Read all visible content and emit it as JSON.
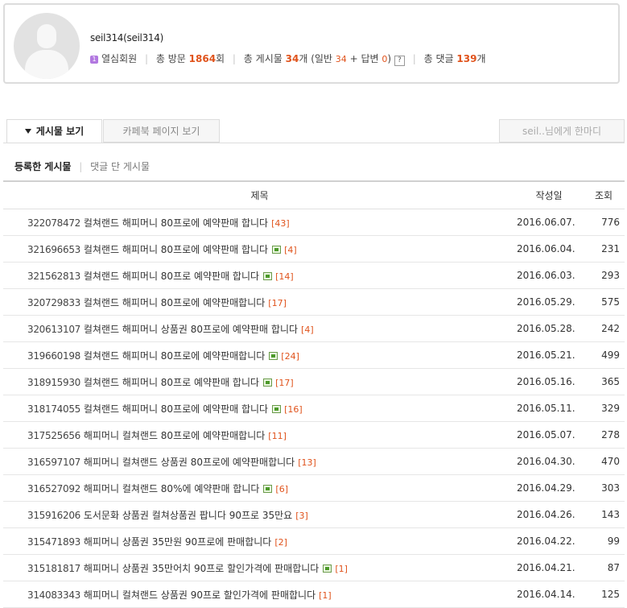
{
  "profile": {
    "nickname": "seil314(seil314)",
    "level_badge": "1",
    "rank": "열심회원",
    "visits_label": "총 방문",
    "visits": "1864",
    "visits_unit": "회",
    "posts_label": "총 게시물",
    "posts": "34",
    "posts_unit": "개",
    "general_label": "(일반",
    "general": "34",
    "plus": "+",
    "reply_label": "답변",
    "reply": "0",
    "close_paren": ")",
    "help_label": "?",
    "comments_label": "총 댓글",
    "comments": "139",
    "comments_unit": "개"
  },
  "tabs": {
    "posts": "게시물 보기",
    "facebook": "카페북 페이지 보기",
    "message": "seil..님에게 한마디"
  },
  "subtabs": {
    "written": "등록한 게시물",
    "commented": "댓글 단 게시물"
  },
  "table": {
    "headers": {
      "title": "제목",
      "date": "작성일",
      "views": "조회"
    },
    "rows": [
      {
        "id": "322078472",
        "title": "컬쳐랜드 해피머니 80프로에 예약판매 합니다",
        "image": false,
        "comments": "[43]",
        "date": "2016.06.07.",
        "views": "776"
      },
      {
        "id": "321696653",
        "title": "컬쳐랜드 해피머니 80프로에 예약판매 합니다",
        "image": true,
        "comments": "[4]",
        "date": "2016.06.04.",
        "views": "231"
      },
      {
        "id": "321562813",
        "title": "컬쳐랜드 해피머니 80프로 예약판매 합니다",
        "image": true,
        "comments": "[14]",
        "date": "2016.06.03.",
        "views": "293"
      },
      {
        "id": "320729833",
        "title": "컬쳐랜드 해피머니 80프로에 예약판매합니다",
        "image": false,
        "comments": "[17]",
        "date": "2016.05.29.",
        "views": "575"
      },
      {
        "id": "320613107",
        "title": "컬쳐랜드 해피머니 상품권 80프로에 예약판매 합니다",
        "image": false,
        "comments": "[4]",
        "date": "2016.05.28.",
        "views": "242"
      },
      {
        "id": "319660198",
        "title": "컬쳐랜드 해피머니 80프로에 예약판매합니다",
        "image": true,
        "comments": "[24]",
        "date": "2016.05.21.",
        "views": "499"
      },
      {
        "id": "318915930",
        "title": "컬쳐랜드 해피머니 80프로 예약판매 합니다",
        "image": true,
        "comments": "[17]",
        "date": "2016.05.16.",
        "views": "365"
      },
      {
        "id": "318174055",
        "title": "컬쳐랜드 해피머니 80프로에 예약판매 합니다",
        "image": true,
        "comments": "[16]",
        "date": "2016.05.11.",
        "views": "329"
      },
      {
        "id": "317525656",
        "title": "해피머니 컬쳐랜드 80프로에 예약판매합니다",
        "image": false,
        "comments": "[11]",
        "date": "2016.05.07.",
        "views": "278"
      },
      {
        "id": "316597107",
        "title": "해피머니 컬쳐랜드 상품권 80프로에 예약판매합니다",
        "image": false,
        "comments": "[13]",
        "date": "2016.04.30.",
        "views": "470"
      },
      {
        "id": "316527092",
        "title": "해피머니 컬쳐랜드 80%에 예약판매 합니다",
        "image": true,
        "comments": "[6]",
        "date": "2016.04.29.",
        "views": "303"
      },
      {
        "id": "315916206",
        "title": "도서문화 상품권 컬쳐상품권 팝니다 90프로 35만요",
        "image": false,
        "comments": "[3]",
        "date": "2016.04.26.",
        "views": "143"
      },
      {
        "id": "315471893",
        "title": "해피머니 상품권 35만원 90프로에 판매합니다",
        "image": false,
        "comments": "[2]",
        "date": "2016.04.22.",
        "views": "99"
      },
      {
        "id": "315181817",
        "title": "해피머니 상품권 35만어치 90프로 할인가격에 판매합니다",
        "image": true,
        "comments": "[1]",
        "date": "2016.04.21.",
        "views": "87"
      },
      {
        "id": "314083343",
        "title": "해피머니 컬쳐랜드 상품권 90프로 할인가격에 판매합니다",
        "image": false,
        "comments": "[1]",
        "date": "2016.04.14.",
        "views": "125"
      }
    ]
  }
}
